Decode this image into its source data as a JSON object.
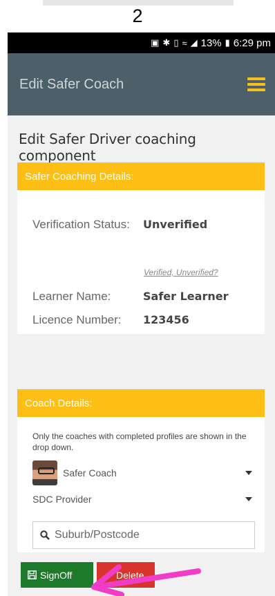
{
  "step_number": "2",
  "status_bar": {
    "battery": "13%",
    "time": "6:29 pm",
    "icons": [
      "cast-icon",
      "bluetooth-icon",
      "volte-icon",
      "wifi-icon",
      "signal-icon",
      "battery-icon"
    ]
  },
  "header": {
    "title": "Edit Safer Coach",
    "menu_icon": "hamburger-icon",
    "accent": "#f7c01a"
  },
  "page": {
    "heading": "Edit Safer Driver coaching component"
  },
  "coaching_details": {
    "title": "Safer Coaching Details:",
    "verification_label": "Verification Status:",
    "verification_value": "Unverified",
    "options_hint": "Verified, Unverified?",
    "learner_label": "Learner Name:",
    "learner_value": "Safer Learner",
    "licence_label": "Licence Number:",
    "licence_value": "123456"
  },
  "coach_details": {
    "title": "Coach Details:",
    "note": "Only the coaches with completed profiles are shown in the drop down.",
    "coach_select": "Safer Coach",
    "provider_select": "SDC Provider",
    "search_placeholder": "Suburb/Postcode"
  },
  "actions": {
    "signoff_label": "SignOff",
    "delete_label": "Delete"
  },
  "colors": {
    "header_bg": "#4d5f68",
    "card_header": "#fdbf14",
    "signoff": "#1d7a2a",
    "delete": "#d9342b",
    "annotation_arrow": "#f03dc8"
  }
}
